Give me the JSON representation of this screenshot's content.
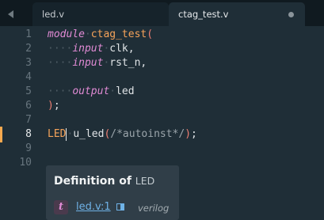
{
  "tabs": [
    {
      "label": "led.v",
      "active": false
    },
    {
      "label": "ctag_test.v",
      "active": true
    }
  ],
  "gutter": [
    "1",
    "2",
    "3",
    "4",
    "5",
    "6",
    "7",
    "8",
    "9",
    "10"
  ],
  "current_line": "8",
  "code": {
    "l1_kw": "module",
    "l1_name": "ctag_test",
    "l1_paren": "(",
    "l2_ws": "····",
    "l2_kw": "input",
    "l2_dot": "·",
    "l2_rest": "clk,",
    "l3_ws": "····",
    "l3_kw": "input",
    "l3_dot": "·",
    "l3_rest": "rst_n,",
    "l5_ws": "····",
    "l5_kw": "output",
    "l5_dot": "·",
    "l5_rest": "led",
    "l6_paren": ")",
    "l6_semi": ";",
    "l8_a": "LED",
    "l8_b": "u_led",
    "l8_p1": "(",
    "l8_cmt": "/*autoinst*/",
    "l8_p2": ")",
    "l8_semi": ";"
  },
  "popup": {
    "title": "Definition of",
    "symbol": "LED",
    "badge": "t",
    "link": "led.v:1",
    "language": "verilog"
  },
  "colors": {
    "background": "#1f2e37",
    "keyword": "#e18bd5",
    "module_name": "#f5a35a",
    "link": "#6fb2e6",
    "current_line_marker": "#f6a94f"
  }
}
